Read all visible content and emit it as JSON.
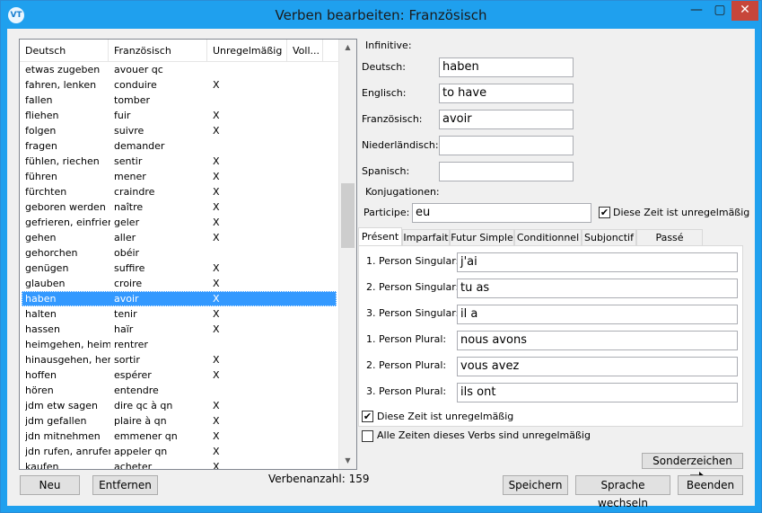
{
  "window": {
    "title": "Verben bearbeiten: Französisch",
    "icon_text": "VT",
    "minimize": "—",
    "maximize": "▢",
    "close": "✕"
  },
  "list": {
    "headers": [
      "Deutsch",
      "Französisch",
      "Unregelmäßig",
      "Voll..."
    ],
    "rows": [
      {
        "de": "etwas zugeben",
        "fr": "avouer qc",
        "irr": ""
      },
      {
        "de": "fahren, lenken",
        "fr": "conduire",
        "irr": "X"
      },
      {
        "de": "fallen",
        "fr": "tomber",
        "irr": ""
      },
      {
        "de": "fliehen",
        "fr": "fuir",
        "irr": "X"
      },
      {
        "de": "folgen",
        "fr": "suivre",
        "irr": "X"
      },
      {
        "de": "fragen",
        "fr": "demander",
        "irr": ""
      },
      {
        "de": "fühlen, riechen",
        "fr": "sentir",
        "irr": "X"
      },
      {
        "de": "führen",
        "fr": "mener",
        "irr": "X"
      },
      {
        "de": "fürchten",
        "fr": "craindre",
        "irr": "X"
      },
      {
        "de": "geboren werden",
        "fr": "naître",
        "irr": "X"
      },
      {
        "de": "gefrieren, einfrieren",
        "fr": "geler",
        "irr": "X"
      },
      {
        "de": "gehen",
        "fr": "aller",
        "irr": "X"
      },
      {
        "de": "gehorchen",
        "fr": "obéir",
        "irr": ""
      },
      {
        "de": "genügen",
        "fr": "suffire",
        "irr": "X"
      },
      {
        "de": "glauben",
        "fr": "croire",
        "irr": "X"
      },
      {
        "de": "haben",
        "fr": "avoir",
        "irr": "X"
      },
      {
        "de": "halten",
        "fr": "tenir",
        "irr": "X"
      },
      {
        "de": "hassen",
        "fr": "haïr",
        "irr": "X"
      },
      {
        "de": "heimgehen, heim...",
        "fr": "rentrer",
        "irr": ""
      },
      {
        "de": "hinausgehen, her...",
        "fr": "sortir",
        "irr": "X"
      },
      {
        "de": "hoffen",
        "fr": "espérer",
        "irr": "X"
      },
      {
        "de": "hören",
        "fr": "entendre",
        "irr": ""
      },
      {
        "de": "jdm etw sagen",
        "fr": "dire qc à qn",
        "irr": "X"
      },
      {
        "de": "jdm gefallen",
        "fr": "plaire à qn",
        "irr": "X"
      },
      {
        "de": "jdn mitnehmen",
        "fr": "emmener qn",
        "irr": "X"
      },
      {
        "de": "jdn rufen, anrufen",
        "fr": "appeler qn",
        "irr": "X"
      },
      {
        "de": "kaufen",
        "fr": "acheter",
        "irr": "X"
      }
    ],
    "selected_index": 15
  },
  "buttons": {
    "new": "Neu",
    "delete": "Entfernen",
    "save": "Speichern",
    "switch_language": "Sprache wechseln",
    "exit": "Beenden",
    "special_chars": "Sonderzeichen"
  },
  "verb_count": "Verbenanzahl: 159",
  "infinitive": {
    "heading": "Infinitive:",
    "fields": [
      {
        "label": "Deutsch:",
        "value": "haben"
      },
      {
        "label": "Englisch:",
        "value": "to have"
      },
      {
        "label": "Französisch:",
        "value": "avoir"
      },
      {
        "label": "Niederländisch:",
        "value": ""
      },
      {
        "label": "Spanisch:",
        "value": ""
      }
    ]
  },
  "conjugations": {
    "heading": "Konjugationen:",
    "participle_label": "Participe:",
    "participle_value": "eu",
    "participle_irregular": "Diese Zeit ist unregelmäßig",
    "participle_irregular_checked": true,
    "tabs": [
      "Présent",
      "Imparfait",
      "Futur Simple",
      "Conditionnel I",
      "Subjonctif",
      "Passé Simple"
    ],
    "active_tab": 0,
    "persons": [
      {
        "label": "1. Person Singular:",
        "value": "j'ai"
      },
      {
        "label": "2. Person Singular:",
        "value": "tu as"
      },
      {
        "label": "3. Person Singular:",
        "value": "il a"
      },
      {
        "label": "1. Person Plural:",
        "value": "nous avons"
      },
      {
        "label": "2. Person Plural:",
        "value": "vous avez"
      },
      {
        "label": "3. Person Plural:",
        "value": "ils ont"
      }
    ],
    "tense_irregular": "Diese Zeit ist unregelmäßig",
    "tense_irregular_checked": true,
    "all_tenses_irregular": "Alle Zeiten dieses Verbs sind unregelmäßig",
    "all_tenses_irregular_checked": false
  },
  "icons": {
    "arrow": "arrow-right-icon",
    "scroll_up": "▲",
    "scroll_down": "▼",
    "check": "✔"
  }
}
